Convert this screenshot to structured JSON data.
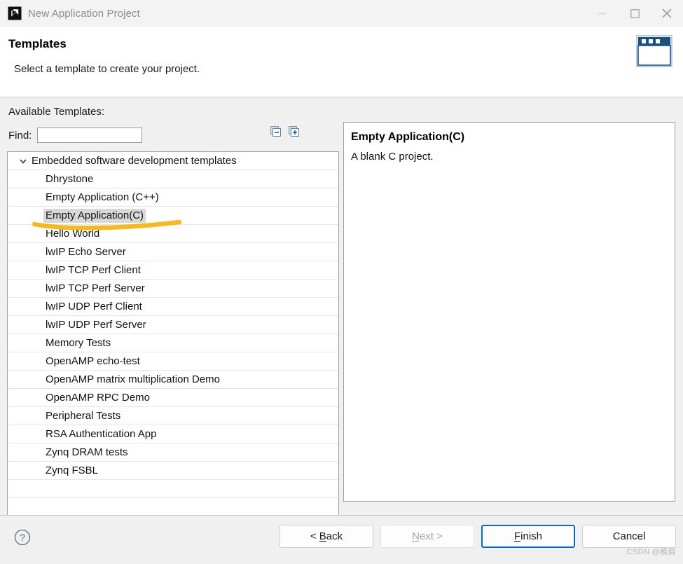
{
  "window": {
    "title": "New Application Project",
    "app_icon": "xilinx-vitis-icon",
    "controls": [
      {
        "name": "minimize-button",
        "icon": "minimize-icon",
        "glyph": "—"
      },
      {
        "name": "maximize-button",
        "icon": "maximize-icon",
        "glyph": "□"
      },
      {
        "name": "close-button",
        "icon": "close-icon",
        "glyph": "✕"
      }
    ]
  },
  "header": {
    "title": "Templates",
    "subtitle": "Select a template to create your project.",
    "banner_icon": "new-project-window-icon",
    "banner_color": "#1e4f81"
  },
  "body": {
    "available_label": "Available Templates:",
    "find_label": "Find:",
    "find_value": "",
    "find_placeholder": "",
    "tools": [
      {
        "name": "collapse-all-button",
        "icon": "collapse-all-icon",
        "tip": "Collapse All"
      },
      {
        "name": "expand-all-button",
        "icon": "expand-all-icon",
        "tip": "Expand All"
      }
    ],
    "tree": {
      "group_label": "Embedded software development templates",
      "expanded": true,
      "selected_index": 2,
      "items": [
        "Dhrystone",
        "Empty Application (C++)",
        "Empty Application(C)",
        "Hello World",
        "lwIP Echo Server",
        "lwIP TCP Perf Client",
        "lwIP TCP Perf Server",
        "lwIP UDP Perf Client",
        "lwIP UDP Perf Server",
        "Memory Tests",
        "OpenAMP echo-test",
        "OpenAMP matrix multiplication Demo",
        "OpenAMP RPC Demo",
        "Peripheral Tests",
        "RSA Authentication App",
        "Zynq DRAM tests",
        "Zynq FSBL"
      ]
    },
    "description": {
      "title": "Empty Application(C)",
      "text": "A blank C project."
    },
    "annotation": {
      "type": "highlighter-underline",
      "color": "#F5B921",
      "target": "Empty Application(C)"
    }
  },
  "footer": {
    "help_icon": "help-question-icon",
    "buttons": [
      {
        "name": "back-button",
        "label": "< Back",
        "mnemonic": "B",
        "state": "enabled"
      },
      {
        "name": "next-button",
        "label": "Next >",
        "mnemonic": "N",
        "state": "disabled"
      },
      {
        "name": "finish-button",
        "label": "Finish",
        "mnemonic": "F",
        "state": "default"
      },
      {
        "name": "cancel-button",
        "label": "Cancel",
        "mnemonic": "",
        "state": "enabled"
      }
    ],
    "watermark": "CSDN @稚肩"
  },
  "colors": {
    "accent": "#0a69c8",
    "banner": "#1e4f81",
    "selection": "#d8d8d8",
    "chrome": "#f0f0f0",
    "titlebar": "#f3f3f3"
  }
}
